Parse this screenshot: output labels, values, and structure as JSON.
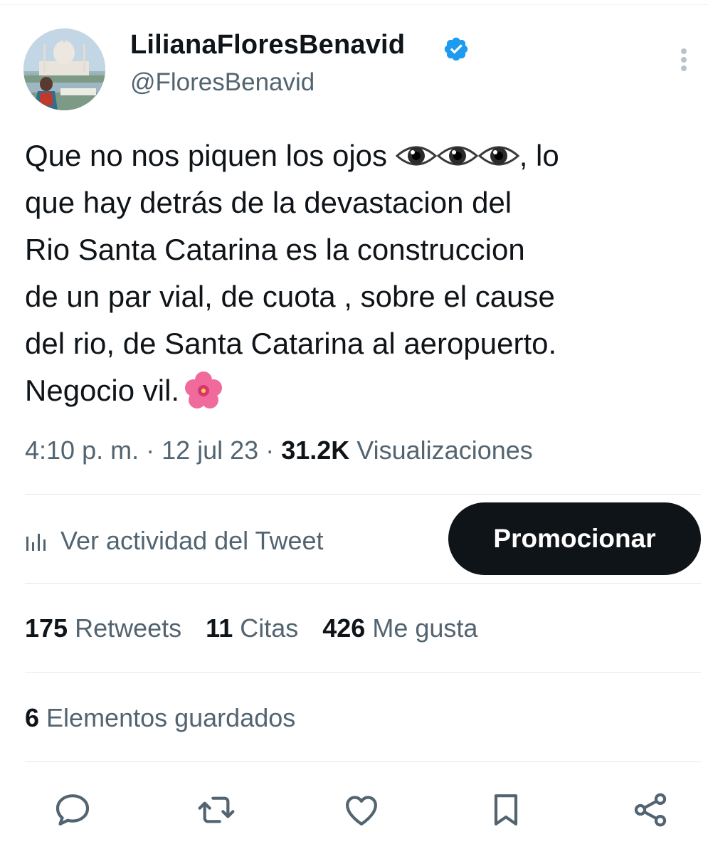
{
  "author": {
    "display_name": "LilianaFloresBenavid",
    "handle": "@FloresBenavid",
    "verified": true,
    "avatar": "profile-photo"
  },
  "tweet": {
    "line1_prefix": "Que no nos piquen los ojos ",
    "line1_suffix": ", lo",
    "body_rest": "que hay detrás de la devastacion del\nRio Santa Catarina es la construccion\nde un par vial, de cuota , sobre el cause\ndel rio, de Santa Catarina al aeropuerto.\nNegocio vil.",
    "emojis": [
      "eye-emoji",
      "eye-emoji",
      "eye-emoji",
      "hibiscus-emoji"
    ]
  },
  "meta": {
    "time": "4:10 p. m.",
    "separator": " · ",
    "date": "12 jul 23",
    "views_count": "31.2K",
    "views_label": " Visualizaciones"
  },
  "activity": {
    "label": "Ver actividad del Tweet",
    "promote_label": "Promocionar"
  },
  "stats": {
    "retweets_count": "175",
    "retweets_label": " Retweets",
    "quotes_count": "11",
    "quotes_label": " Citas",
    "likes_count": "426",
    "likes_label": " Me gusta"
  },
  "saved": {
    "count": "6",
    "label": " Elementos guardados"
  },
  "actions": [
    "reply-icon",
    "retweet-icon",
    "like-icon",
    "bookmark-icon",
    "share-icon"
  ],
  "colors": {
    "text": "#0f1419",
    "secondary": "#536471",
    "verified": "#1d9bf0",
    "button_bg": "#0f1419",
    "divider": "#e1e8ed"
  }
}
